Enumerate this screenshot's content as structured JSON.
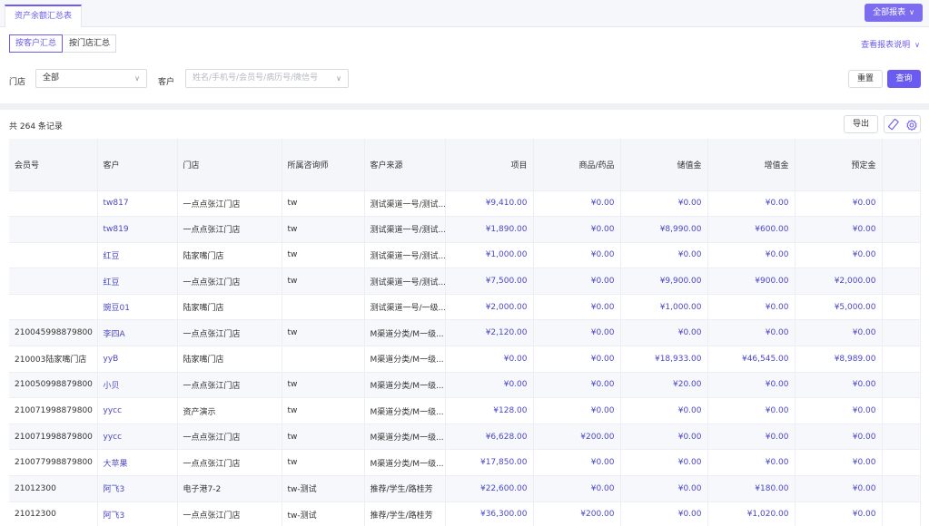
{
  "topbar": {
    "active_tab": "资产余额汇总表",
    "all_reports_label": "全部报表"
  },
  "filters": {
    "segments": [
      "按客户汇总",
      "按门店汇总"
    ],
    "active_segment": 0,
    "view_desc_label": "查看报表说明",
    "store_label": "门店",
    "store_value": "全部",
    "customer_label": "客户",
    "customer_placeholder": "姓名/手机号/会员号/病历号/微信号",
    "reset_label": "重置",
    "query_label": "查询"
  },
  "results": {
    "count_text": "共 264 条记录",
    "export_label": "导出",
    "icons": [
      "ruler-icon",
      "gear-icon"
    ],
    "columns": [
      "会员号",
      "客户",
      "门店",
      "所属咨询师",
      "客户来源",
      "项目",
      "商品/药品",
      "储值金",
      "增值金",
      "预定金",
      ""
    ],
    "rows": [
      [
        "",
        "tw817",
        "一点点张江门店",
        "tw",
        "测试渠道一号/测试...",
        "¥9,410.00",
        "¥0.00",
        "¥0.00",
        "¥0.00",
        "¥0.00",
        ""
      ],
      [
        "",
        "tw819",
        "一点点张江门店",
        "tw",
        "测试渠道一号/测试...",
        "¥1,890.00",
        "¥0.00",
        "¥8,990.00",
        "¥600.00",
        "¥0.00",
        ""
      ],
      [
        "",
        "红豆",
        "陆家嘴门店",
        "tw",
        "测试渠道一号/测试...",
        "¥1,000.00",
        "¥0.00",
        "¥0.00",
        "¥0.00",
        "¥0.00",
        ""
      ],
      [
        "",
        "红豆",
        "一点点张江门店",
        "tw",
        "测试渠道一号/测试...",
        "¥7,500.00",
        "¥0.00",
        "¥9,900.00",
        "¥900.00",
        "¥2,000.00",
        ""
      ],
      [
        "",
        "豌豆01",
        "陆家嘴门店",
        "",
        "测试渠道一号/一级...",
        "¥2,000.00",
        "¥0.00",
        "¥1,000.00",
        "¥0.00",
        "¥5,000.00",
        ""
      ],
      [
        "210045998879800",
        "李四A",
        "一点点张江门店",
        "tw",
        "M渠道分类/M一级...",
        "¥2,120.00",
        "¥0.00",
        "¥0.00",
        "¥0.00",
        "¥0.00",
        ""
      ],
      [
        "210003陆家嘴门店",
        "yyB",
        "陆家嘴门店",
        "",
        "M渠道分类/M一级...",
        "¥0.00",
        "¥0.00",
        "¥18,933.00",
        "¥46,545.00",
        "¥8,989.00",
        ""
      ],
      [
        "210050998879800",
        "小贝",
        "一点点张江门店",
        "tw",
        "M渠道分类/M一级...",
        "¥0.00",
        "¥0.00",
        "¥20.00",
        "¥0.00",
        "¥0.00",
        ""
      ],
      [
        "210071998879800",
        "yycc",
        "资产演示",
        "tw",
        "M渠道分类/M一级...",
        "¥128.00",
        "¥0.00",
        "¥0.00",
        "¥0.00",
        "¥0.00",
        ""
      ],
      [
        "210071998879800",
        "yycc",
        "一点点张江门店",
        "tw",
        "M渠道分类/M一级...",
        "¥6,628.00",
        "¥200.00",
        "¥0.00",
        "¥0.00",
        "¥0.00",
        ""
      ],
      [
        "210077998879800",
        "大苹果",
        "一点点张江门店",
        "tw",
        "M渠道分类/M一级...",
        "¥17,850.00",
        "¥0.00",
        "¥0.00",
        "¥0.00",
        "¥0.00",
        ""
      ],
      [
        "21012300",
        "阿飞3",
        "电子港7-2",
        "tw-测试",
        "推荐/学生/路桂芳",
        "¥22,600.00",
        "¥0.00",
        "¥0.00",
        "¥180.00",
        "¥0.00",
        ""
      ],
      [
        "21012300",
        "阿飞3",
        "一点点张江门店",
        "tw-测试",
        "推荐/学生/路桂芳",
        "¥36,300.00",
        "¥200.00",
        "¥0.00",
        "¥1,020.00",
        "¥0.00",
        ""
      ]
    ]
  }
}
